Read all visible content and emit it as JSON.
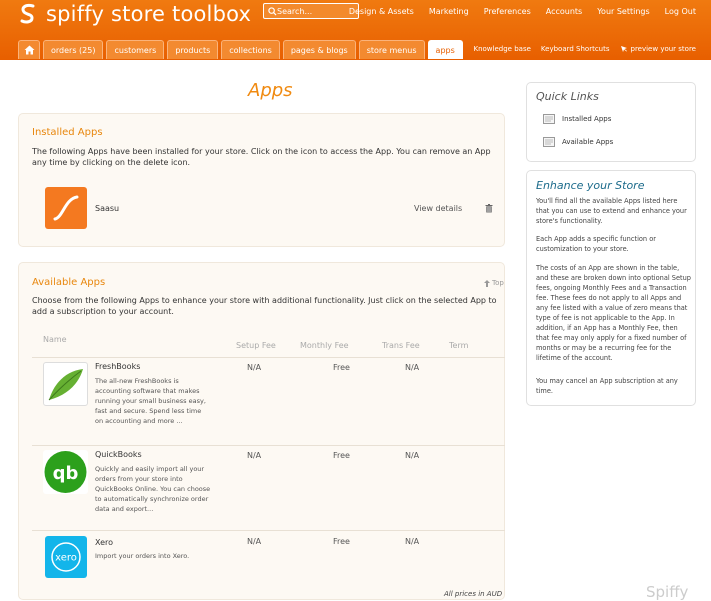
{
  "app": {
    "title": "spiffy store toolbox"
  },
  "search": {
    "placeholder": "Search..."
  },
  "topnav": [
    "Design & Assets",
    "Marketing",
    "Preferences",
    "Accounts",
    "Your Settings",
    "Log Out"
  ],
  "tabs": [
    "orders (25)",
    "customers",
    "products",
    "collections",
    "pages & blogs",
    "store menus",
    "apps"
  ],
  "active_tab": "apps",
  "subnav": {
    "kb": "Knowledge base",
    "shortcuts": "Keyboard Shortcuts",
    "preview": "preview your store"
  },
  "page_title": "Apps",
  "installed": {
    "heading": "Installed Apps",
    "description": "The following Apps have been installed for your store. Click on the icon to access the App. You can remove an App any time by clicking on the delete icon.",
    "apps": [
      {
        "name": "Saasu",
        "details_label": "View details"
      }
    ]
  },
  "available": {
    "heading": "Available Apps",
    "top_link": "Top",
    "description": "Choose from the following Apps to enhance your store with additional functionality. Just click on the selected App to add a subscription to your account.",
    "columns": [
      "Name",
      "Setup Fee",
      "Monthly Fee",
      "Trans Fee",
      "Term"
    ],
    "apps": [
      {
        "name": "FreshBooks",
        "description": "The all-new FreshBooks is accounting software that makes running your small business easy, fast and secure. Spend less time on accounting and more ...",
        "setup": "N/A",
        "monthly": "Free",
        "trans": "N/A",
        "term": ""
      },
      {
        "name": "QuickBooks",
        "description": "Quickly and easily import all your orders from your store into QuickBooks Online. You can choose to automatically synchronize order data and export...",
        "setup": "N/A",
        "monthly": "Free",
        "trans": "N/A",
        "term": ""
      },
      {
        "name": "Xero",
        "description": "Import your orders into Xero.",
        "setup": "N/A",
        "monthly": "Free",
        "trans": "N/A",
        "term": ""
      }
    ],
    "footer_note": "All prices in AUD"
  },
  "quick_links": {
    "title": "Quick Links",
    "items": [
      "Installed Apps",
      "Available Apps"
    ]
  },
  "enhance": {
    "title": "Enhance your Store",
    "paragraphs": [
      "You'll find all the available Apps listed here that you can use to extend and enhance your store's functionality.",
      "Each App adds a specific function or customization to your store.",
      "The costs of an App are shown in the table, and these are broken down into optional Setup fees, ongoing Monthly Fees and a Transaction fee. These fees do not apply to all Apps and any fee listed with a value of zero means that type of fee is not applicable to the App. In addition, if an App has a Monthly Fee, then that fee may only apply for a fixed number of months or may be a recurring fee for the lifetime of the account.",
      "You may cancel an App subscription at any time."
    ]
  },
  "watermark": "Spiffy",
  "colors": {
    "brand_orange": "#e85f00",
    "accent": "#f08a10",
    "quickbooks_green": "#2ca01c",
    "xero_blue": "#13b5ea"
  }
}
